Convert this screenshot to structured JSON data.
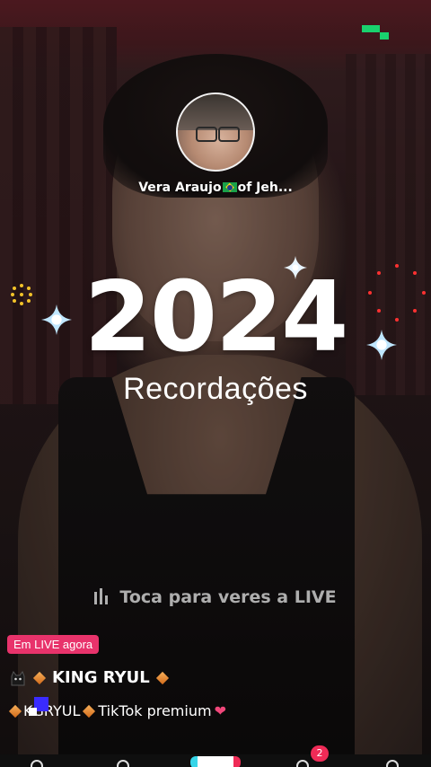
{
  "profile": {
    "name_prefix": "Vera Araujo",
    "name_suffix": "of Jeh..."
  },
  "recap": {
    "year": "2024",
    "subtitle": "Recordações"
  },
  "hint": {
    "tap_text": "Toca para veres a LIVE"
  },
  "live": {
    "badge": "Em LIVE agora",
    "host_name": "KING RYUL",
    "desc_name": "K​GRYUL",
    "desc_text": "TikTok premium",
    "heart": "❤"
  },
  "nav": {
    "inbox_badge": "2"
  },
  "colors": {
    "live_badge": "#e8336b",
    "logo_green": "#19d26e",
    "accent_red": "#ef2b57",
    "accent_cyan": "#36d5e8"
  },
  "icons": [
    "pixel-logo-icon",
    "sparkle-icon",
    "dot-ring-icon",
    "cat-icon",
    "diamond-icon",
    "audio-bars-icon",
    "heart-icon",
    "brazil-flag-icon"
  ]
}
